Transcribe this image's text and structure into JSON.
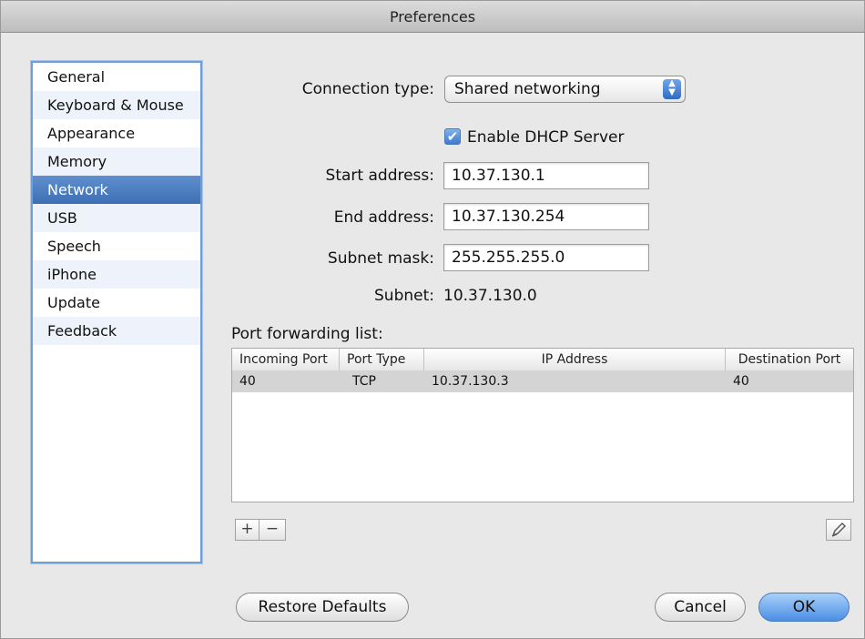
{
  "window": {
    "title": "Preferences"
  },
  "sidebar": {
    "items": [
      {
        "label": "General"
      },
      {
        "label": "Keyboard & Mouse"
      },
      {
        "label": "Appearance"
      },
      {
        "label": "Memory"
      },
      {
        "label": "Network",
        "selected": true
      },
      {
        "label": "USB"
      },
      {
        "label": "Speech"
      },
      {
        "label": "iPhone"
      },
      {
        "label": "Update"
      },
      {
        "label": "Feedback"
      }
    ]
  },
  "network": {
    "connection_type_label": "Connection type:",
    "connection_type_value": "Shared networking",
    "dhcp_label": "Enable DHCP Server",
    "dhcp_checked": true,
    "start_address_label": "Start address:",
    "start_address_value": "10.37.130.1",
    "end_address_label": "End address:",
    "end_address_value": "10.37.130.254",
    "subnet_mask_label": "Subnet mask:",
    "subnet_mask_value": "255.255.255.0",
    "subnet_label": "Subnet:",
    "subnet_value": "10.37.130.0",
    "port_forwarding_label": "Port forwarding list:"
  },
  "port_table": {
    "columns": [
      "Incoming Port",
      "Port Type",
      "IP Address",
      "Destination Port"
    ],
    "rows": [
      [
        "40",
        "TCP",
        "10.37.130.3",
        "40"
      ]
    ]
  },
  "table_controls": {
    "add_label": "+",
    "remove_label": "−",
    "edit_icon": "pencil-icon"
  },
  "footer": {
    "restore_defaults_label": "Restore Defaults",
    "cancel_label": "Cancel",
    "ok_label": "OK"
  },
  "colors": {
    "selection": "#3d6fb4",
    "sidebar_border": "#6f9fd6",
    "default_button": "#4b8ee3"
  }
}
